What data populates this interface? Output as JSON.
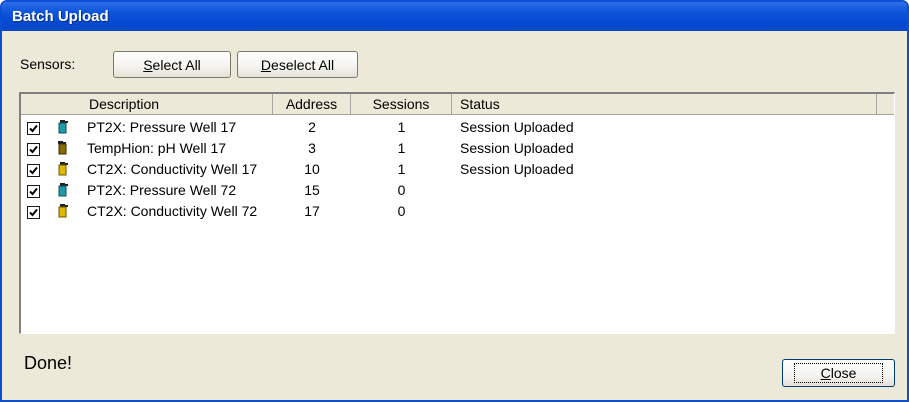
{
  "window": {
    "title": "Batch Upload"
  },
  "toolbar": {
    "sensors_label": "Sensors:",
    "select_all": {
      "underline": "S",
      "rest": "elect All"
    },
    "deselect_all": {
      "underline": "D",
      "rest": "eselect All"
    }
  },
  "table": {
    "columns": [
      "Description",
      "Address",
      "Sessions",
      "Status"
    ],
    "rows": [
      {
        "checked": true,
        "icon": "pressure-sensor-icon",
        "description": "PT2X: Pressure Well 17",
        "address": "2",
        "sessions": "1",
        "status": "Session Uploaded"
      },
      {
        "checked": true,
        "icon": "ph-sensor-icon",
        "description": "TempHion: pH Well 17",
        "address": "3",
        "sessions": "1",
        "status": "Session Uploaded"
      },
      {
        "checked": true,
        "icon": "conductivity-sensor-icon",
        "description": "CT2X: Conductivity Well 17",
        "address": "10",
        "sessions": "1",
        "status": "Session Uploaded"
      },
      {
        "checked": true,
        "icon": "pressure-sensor-icon",
        "description": "PT2X: Pressure Well 72",
        "address": "15",
        "sessions": "0",
        "status": ""
      },
      {
        "checked": true,
        "icon": "conductivity-sensor-icon",
        "description": "CT2X: Conductivity Well 72",
        "address": "17",
        "sessions": "0",
        "status": ""
      }
    ]
  },
  "status_text": "Done!",
  "close_button": {
    "underline": "C",
    "rest": "lose"
  },
  "colors": {
    "titlebar": "#0549d1",
    "window_face": "#ece9d8",
    "pressure_icon": "#1f9aa8",
    "ph_icon": "#8a6a00",
    "conductivity_icon": "#e0b800"
  }
}
